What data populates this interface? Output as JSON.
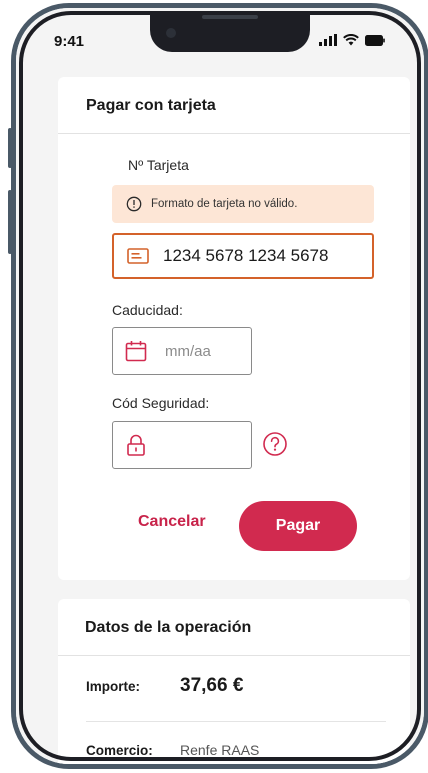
{
  "status_bar": {
    "time": "9:41"
  },
  "payment": {
    "title": "Pagar con tarjeta",
    "card_number_label": "Nº Tarjeta",
    "error_message": "Formato de tarjeta no válido.",
    "card_number_value": "1234 5678 1234 5678",
    "expiry_label": "Caducidad:",
    "expiry_placeholder": "mm/aa",
    "security_label": "Cód Seguridad:",
    "security_value": "",
    "cancel_label": "Cancelar",
    "pay_label": "Pagar"
  },
  "operation": {
    "title": "Datos de la operación",
    "amount_label": "Importe:",
    "amount_value": "37,66 €",
    "merchant_label": "Comercio:",
    "merchant_value": "Renfe RAAS"
  },
  "colors": {
    "accent": "#d12a4f",
    "error_border": "#d4622a",
    "error_bg": "#fde6d6",
    "frame": "#4a5967"
  },
  "icons": {
    "error": "info-circle-icon",
    "card": "credit-card-icon",
    "expiry": "calendar-icon",
    "security": "lock-icon",
    "help": "question-circle-icon"
  }
}
